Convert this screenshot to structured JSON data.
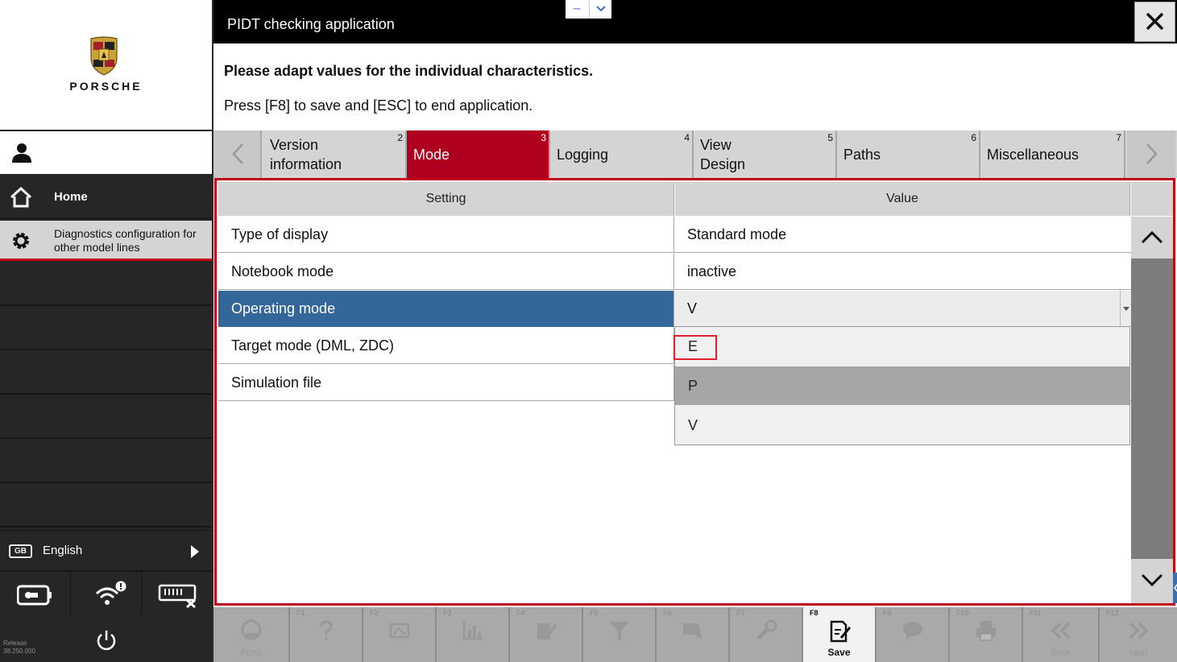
{
  "brand": {
    "name": "PORSCHE"
  },
  "sidebar": {
    "home_label": "Home",
    "diag_label": "Diagnostics configuration for other model lines",
    "language_code": "GB",
    "language_label": "English",
    "release_label": "Release",
    "release_version": "38.250.000"
  },
  "window": {
    "title": "PIDT checking application",
    "minimize_symbol": "–"
  },
  "instructions": {
    "line1": "Please adapt values for the individual characteristics.",
    "line2": "Press [F8] to save and [ESC] to end application."
  },
  "tabs": [
    {
      "num": "2",
      "line1": "Version",
      "line2": "information"
    },
    {
      "num": "3",
      "line1": "Mode",
      "line2": ""
    },
    {
      "num": "4",
      "line1": "Logging",
      "line2": ""
    },
    {
      "num": "5",
      "line1": "View",
      "line2": "Design"
    },
    {
      "num": "6",
      "line1": "Paths",
      "line2": ""
    },
    {
      "num": "7",
      "line1": "Miscellaneous",
      "line2": ""
    }
  ],
  "table": {
    "header_setting": "Setting",
    "header_value": "Value",
    "rows": [
      {
        "setting": "Type of display",
        "value": "Standard mode"
      },
      {
        "setting": "Notebook mode",
        "value": "inactive"
      },
      {
        "setting": "Operating mode",
        "value": "V"
      },
      {
        "setting": "Target mode (DML, ZDC)",
        "value": ""
      },
      {
        "setting": "Simulation file",
        "value": ""
      }
    ]
  },
  "dropdown_options": [
    "E",
    "P",
    "V"
  ],
  "toolbar": [
    {
      "key": "",
      "label": "POIS"
    },
    {
      "key": "F1",
      "label": ""
    },
    {
      "key": "F2",
      "label": ""
    },
    {
      "key": "F3",
      "label": ""
    },
    {
      "key": "F4",
      "label": ""
    },
    {
      "key": "F5",
      "label": ""
    },
    {
      "key": "F6",
      "label": ""
    },
    {
      "key": "F7",
      "label": ""
    },
    {
      "key": "F8",
      "label": "Save"
    },
    {
      "key": "F9",
      "label": ""
    },
    {
      "key": "F10",
      "label": ""
    },
    {
      "key": "F11",
      "label": "Back"
    },
    {
      "key": "F12",
      "label": "Next"
    }
  ],
  "colors": {
    "accent_red": "#b0001f",
    "selected_blue": "#336699",
    "highlight_red": "#e0202c"
  }
}
